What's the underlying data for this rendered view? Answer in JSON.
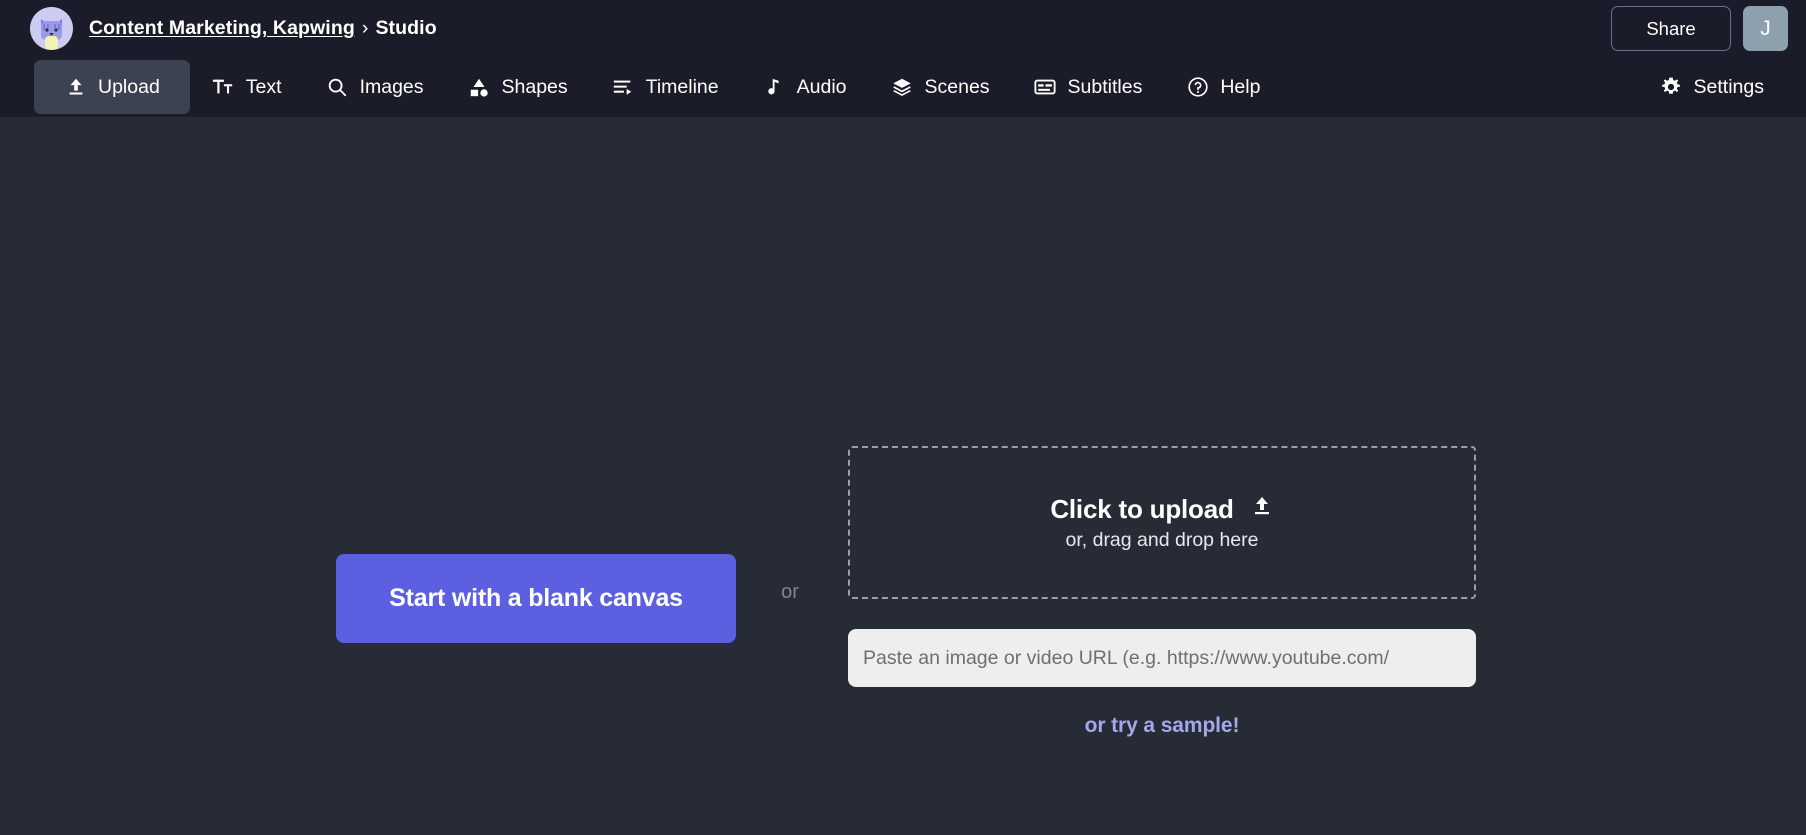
{
  "header": {
    "avatar_icon": "cat-avatar-icon",
    "breadcrumb": {
      "workspace": "Content Marketing, Kapwing",
      "separator": "›",
      "current": "Studio"
    },
    "share_label": "Share",
    "user_initial": "J"
  },
  "toolbar": {
    "items": [
      {
        "label": "Upload",
        "icon": "upload-icon",
        "active": true
      },
      {
        "label": "Text",
        "icon": "text-icon",
        "active": false
      },
      {
        "label": "Images",
        "icon": "search-icon",
        "active": false
      },
      {
        "label": "Shapes",
        "icon": "shapes-icon",
        "active": false
      },
      {
        "label": "Timeline",
        "icon": "timeline-icon",
        "active": false
      },
      {
        "label": "Audio",
        "icon": "music-note-icon",
        "active": false
      },
      {
        "label": "Scenes",
        "icon": "layers-icon",
        "active": false
      },
      {
        "label": "Subtitles",
        "icon": "subtitles-icon",
        "active": false
      },
      {
        "label": "Help",
        "icon": "help-circle-icon",
        "active": false
      }
    ],
    "settings_label": "Settings",
    "settings_icon": "gear-icon"
  },
  "main": {
    "blank_canvas_label": "Start with a blank canvas",
    "or_label": "or",
    "dropzone": {
      "title": "Click to upload",
      "icon": "upload-icon",
      "subtitle": "or, drag and drop here"
    },
    "url_placeholder": "Paste an image or video URL (e.g. https://www.youtube.com/",
    "url_value": "",
    "try_sample_label": "or try a sample!"
  },
  "colors": {
    "background": "#272b36",
    "chrome": "#1a1d29",
    "active_tab": "#3c4252",
    "accent_button": "#5b5fe0",
    "link_accent": "#a3a8e8",
    "avatar_bg": "#8ca0ad"
  }
}
